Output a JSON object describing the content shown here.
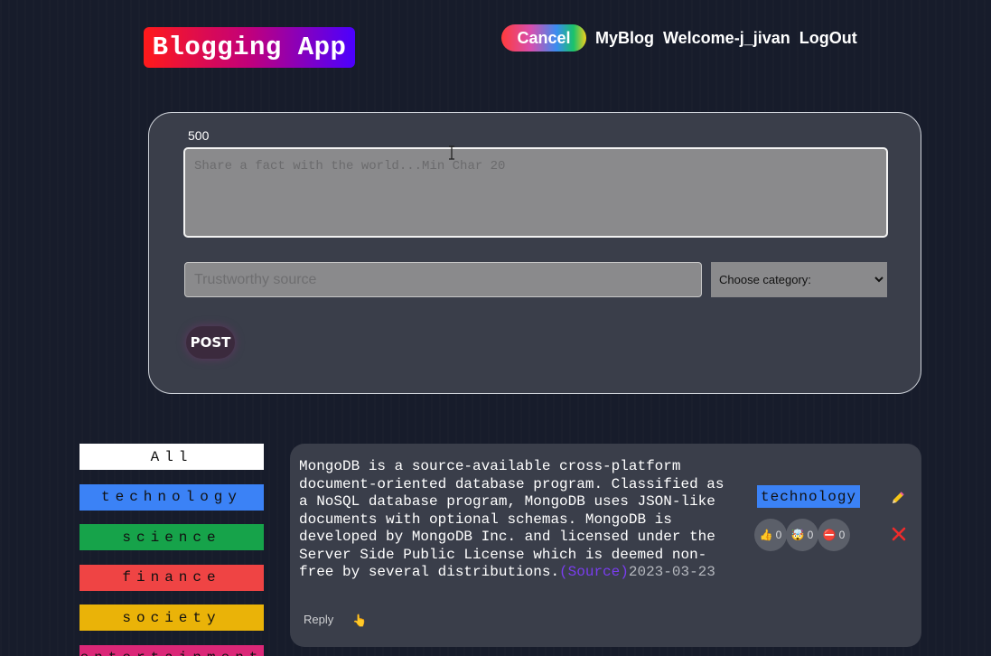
{
  "header": {
    "logo": "Blogging App",
    "nav": {
      "cancel": "Cancel",
      "my_blog": "MyBlog",
      "welcome": "Welcome-j_jivan",
      "logout": "LogOut"
    }
  },
  "form": {
    "char_count": "500",
    "fact_placeholder": "Share a fact with the world...Min Char 20",
    "source_placeholder": "Trustworthy source",
    "category_selected": "Choose category:",
    "post_label": "POST"
  },
  "categories": [
    {
      "label": "All",
      "color": "#ffffff"
    },
    {
      "label": "technology",
      "color": "#3b82f6"
    },
    {
      "label": "science",
      "color": "#16a34a"
    },
    {
      "label": "finance",
      "color": "#ef4444"
    },
    {
      "label": "society",
      "color": "#eab308"
    },
    {
      "label": "entertainment",
      "color": "#db2777"
    }
  ],
  "fact": {
    "text": "MongoDB is a source-available cross-platform document-oriented database program. Classified as a NoSQL database program, MongoDB uses JSON-like documents with optional schemas. MongoDB is developed by MongoDB Inc. and licensed under the Server Side Public License which is deemed non-free by several distributions.",
    "source_label": "(Source)",
    "date": "2023-03-23",
    "tag": "technology",
    "tag_color": "#3b82f6",
    "votes": [
      {
        "icon": "👍",
        "name": "thumbs-up-icon",
        "count": "0"
      },
      {
        "icon": "🤯",
        "name": "mind-blown-icon",
        "count": "0"
      },
      {
        "icon": "⛔",
        "name": "no-entry-icon",
        "count": "0"
      }
    ],
    "reply_label": "Reply",
    "reply_icon": "pointing-hand-icon",
    "edit_icon": "pencil-icon",
    "delete_icon": "close-icon"
  }
}
